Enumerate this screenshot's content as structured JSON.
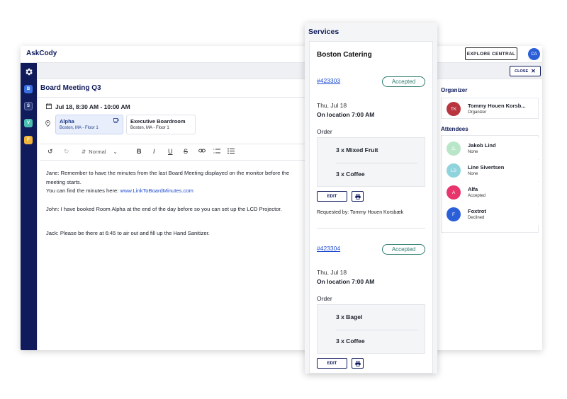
{
  "app": {
    "logo": "AskCody",
    "explore_label": "EXPLORE CENTRAL",
    "user_initials": "CA",
    "close_label": "CLOSE"
  },
  "sidebar": {
    "items": [
      {
        "icon": "gear-icon"
      },
      {
        "icon": "booking-icon",
        "letter": "B",
        "color": "#3a6fe0"
      },
      {
        "icon": "services-icon",
        "letter": "S",
        "color": "#2a3a7a"
      },
      {
        "icon": "visitors-icon",
        "letter": "V",
        "color": "#4cc0b0"
      },
      {
        "icon": "facilities-icon",
        "letter": "F",
        "color": "#f0b43a"
      }
    ]
  },
  "meeting": {
    "title": "Board Meeting Q3",
    "datetime": "Jul 18, 8:30 AM - 10:00 AM",
    "rooms": [
      {
        "name": "Alpha",
        "location": "Boston, MA - Floor 1"
      },
      {
        "name": "Executive Boardroom",
        "location": "Boston, MA - Floor 1"
      }
    ]
  },
  "editor": {
    "style_label": "Normal",
    "p1": "Jane: Remember to have the minutes from the last Board Meeting displayed on the monitor before the meeting starts.",
    "p1b_prefix": "You can find the minutes here: ",
    "p1b_link": "www.LinkToBoardMinutes.com",
    "p2": "John: I have booked Room Alpha at the end of the day before so you can set up the LCD Projector.",
    "p3": "Jack: Please be there at 6:45 to air out and fill up the Hand Sanitizer."
  },
  "organizer": {
    "heading": "Organizer",
    "initials": "TK",
    "name": "Tommy Houen Korsb...",
    "role": "Organizer",
    "color": "#b8343f"
  },
  "attendees": {
    "heading": "Attendees",
    "list": [
      {
        "initials": "JL",
        "name": "Jakob Lind",
        "status": "None",
        "color": "#b9e6c8",
        "fg": "#ffffff"
      },
      {
        "initials": "LS",
        "name": "Line Sivertsen",
        "status": "None",
        "color": "#8fd3dc",
        "fg": "#ffffff"
      },
      {
        "initials": "A",
        "name": "Alfa",
        "status": "Accepted",
        "color": "#e8356b",
        "fg": "#ffffff"
      },
      {
        "initials": "F",
        "name": "Foxtrot",
        "status": "Declined",
        "color": "#2b5fd8",
        "fg": "#ffffff"
      }
    ]
  },
  "services": {
    "title": "Services",
    "caterer": "Boston Catering",
    "orders": [
      {
        "id": "#423303",
        "status": "Accepted",
        "day": "Thu, Jul 18",
        "on_location": "On location 7:00 AM",
        "order_label": "Order",
        "items": [
          "3 x Mixed Fruit",
          "3 x Coffee"
        ],
        "edit_label": "EDIT",
        "requested_by": "Requested by: Tommy Houen Korsbæk"
      },
      {
        "id": "#423304",
        "status": "Accepted",
        "day": "Thu, Jul 18",
        "on_location": "On location 7:00 AM",
        "order_label": "Order",
        "items": [
          "3 x Bagel",
          "3 x Coffee"
        ],
        "edit_label": "EDIT"
      }
    ]
  }
}
